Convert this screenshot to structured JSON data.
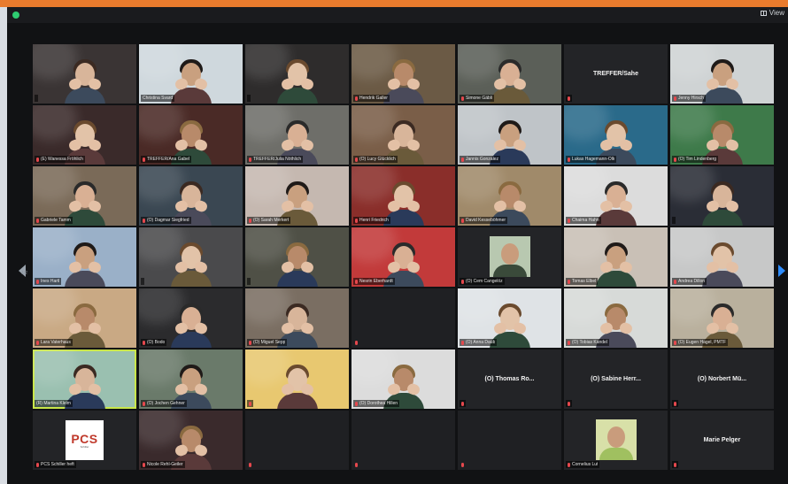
{
  "window": {
    "view_label": "View",
    "accent": "#e97b2d",
    "active_speaker_color": "#c9e64a",
    "muted_color": "#e5484d"
  },
  "nav": {
    "page_left": "1/2",
    "page_right": ""
  },
  "tiles": [
    {
      "name": "",
      "kind": "video",
      "bg": "#3a3434",
      "muted": false
    },
    {
      "name": "Christina Svard",
      "kind": "video",
      "bg": "#cfd8dd",
      "muted": false
    },
    {
      "name": "",
      "kind": "video",
      "bg": "#2e2c2c",
      "muted": false
    },
    {
      "name": "Hendrik Galler",
      "kind": "video",
      "bg": "#6b5a45",
      "muted": true
    },
    {
      "name": "Simone Gäbli",
      "kind": "video",
      "bg": "#5b5f58",
      "muted": true
    },
    {
      "name": "TREFFER/Sahe",
      "kind": "text",
      "bg": "#232427",
      "muted": true
    },
    {
      "name": "Jenny Hirsch",
      "kind": "video",
      "bg": "#cfd3d4",
      "muted": true
    },
    {
      "name": "(E) Wanessa Fröhlich",
      "kind": "video",
      "bg": "#3a2a2a",
      "muted": true
    },
    {
      "name": "TREFFER/Ana Gabel",
      "kind": "video",
      "bg": "#4a2a26",
      "muted": true
    },
    {
      "name": "TREFFER/Julia Nöthlich",
      "kind": "video",
      "bg": "#6e6e69",
      "muted": true
    },
    {
      "name": "(O) Lucy Glücklich",
      "kind": "video",
      "bg": "#7a5e48",
      "muted": true
    },
    {
      "name": "Jannis Gonzalez",
      "kind": "video",
      "bg": "#bfc4c8",
      "muted": true
    },
    {
      "name": "Lukas Hagemann-Olk",
      "kind": "video",
      "bg": "#2a6a8a",
      "muted": true
    },
    {
      "name": "(O) Tim Lindenberg",
      "kind": "video",
      "bg": "#3e7a4a",
      "muted": true
    },
    {
      "name": "Gabriele Tamm",
      "kind": "video",
      "bg": "#7a6a58",
      "muted": true
    },
    {
      "name": "(O) Dagmar Siegfried",
      "kind": "video",
      "bg": "#3a4752",
      "muted": true
    },
    {
      "name": "(O) Sarah Merkert",
      "kind": "video",
      "bg": "#c5b8b0",
      "muted": true
    },
    {
      "name": "Henri Friedrich",
      "kind": "video",
      "bg": "#8a2e2a",
      "muted": true
    },
    {
      "name": "David Kesseböhmer",
      "kind": "video",
      "bg": "#a08a6a",
      "muted": true
    },
    {
      "name": "Chaima Hahn",
      "kind": "video",
      "bg": "#dcdcdc",
      "muted": true
    },
    {
      "name": "",
      "kind": "video",
      "bg": "#2a2d36",
      "muted": false
    },
    {
      "name": "Ines Hartl",
      "kind": "video",
      "bg": "#9ab0c8",
      "muted": true
    },
    {
      "name": "",
      "kind": "video",
      "bg": "#4a4a4c",
      "muted": false
    },
    {
      "name": "",
      "kind": "video",
      "bg": "#4f5046",
      "muted": false
    },
    {
      "name": "Nesrin Eberhardt",
      "kind": "video",
      "bg": "#c23a3a",
      "muted": true
    },
    {
      "name": "(O) Cem Cangelöz",
      "kind": "avatar",
      "bg": "#232427",
      "muted": true
    },
    {
      "name": "Tomas Elbel",
      "kind": "video",
      "bg": "#c9c0b6",
      "muted": true
    },
    {
      "name": "Andrea Dillon",
      "kind": "video",
      "bg": "#c7c8c8",
      "muted": true
    },
    {
      "name": "Lara Vaterhaus",
      "kind": "video",
      "bg": "#c9a984",
      "muted": true
    },
    {
      "name": "(O) Bodo",
      "kind": "video",
      "bg": "#2b2b2d",
      "muted": true
    },
    {
      "name": "(O) Miguel Sepp",
      "kind": "video",
      "bg": "#7a6e62",
      "muted": true
    },
    {
      "name": "",
      "kind": "empty",
      "bg": "#1f2023",
      "muted": true
    },
    {
      "name": "(O) Anna Daub",
      "kind": "video",
      "bg": "#dfe3e6",
      "muted": true
    },
    {
      "name": "(O) Tobias Kandel",
      "kind": "video",
      "bg": "#d7dad8",
      "muted": true
    },
    {
      "name": "(O) Eugen Hagel, PMTF",
      "kind": "video",
      "bg": "#b9b09d",
      "muted": true
    },
    {
      "name": "(R) Martina Kleim",
      "kind": "video",
      "bg": "#9ac0b0",
      "muted": false,
      "active": true
    },
    {
      "name": "(O) Jochen Gehner",
      "kind": "video",
      "bg": "#6a7a6a",
      "muted": true
    },
    {
      "name": "",
      "kind": "video",
      "bg": "#e8c870",
      "muted": true
    },
    {
      "name": "(O) Dorothea Hillen",
      "kind": "video",
      "bg": "#dcdcdc",
      "muted": true
    },
    {
      "name": "(O) Thomas Ro...",
      "kind": "text",
      "bg": "#232427",
      "muted": true
    },
    {
      "name": "(O) Sabine Herr...",
      "kind": "text",
      "bg": "#232427",
      "muted": true
    },
    {
      "name": "(O) Norbert Mü...",
      "kind": "text",
      "bg": "#232427",
      "muted": true
    },
    {
      "name": "PCS Schiller heft",
      "kind": "logo",
      "bg": "#232427",
      "muted": true,
      "logo_text": "PCS",
      "logo_sub": "Schiller"
    },
    {
      "name": "Nicole Rehl-Geiler",
      "kind": "video",
      "bg": "#3a2a2c",
      "muted": true
    },
    {
      "name": "",
      "kind": "empty",
      "bg": "#1f2023",
      "muted": true
    },
    {
      "name": "",
      "kind": "empty",
      "bg": "#1f2023",
      "muted": true
    },
    {
      "name": "",
      "kind": "empty",
      "bg": "#1f2023",
      "muted": true
    },
    {
      "name": "Cornelius Lut",
      "kind": "avatar2",
      "bg": "#232427",
      "muted": true
    },
    {
      "name": "Marie Pelger",
      "kind": "text",
      "bg": "#232427",
      "muted": true
    }
  ]
}
